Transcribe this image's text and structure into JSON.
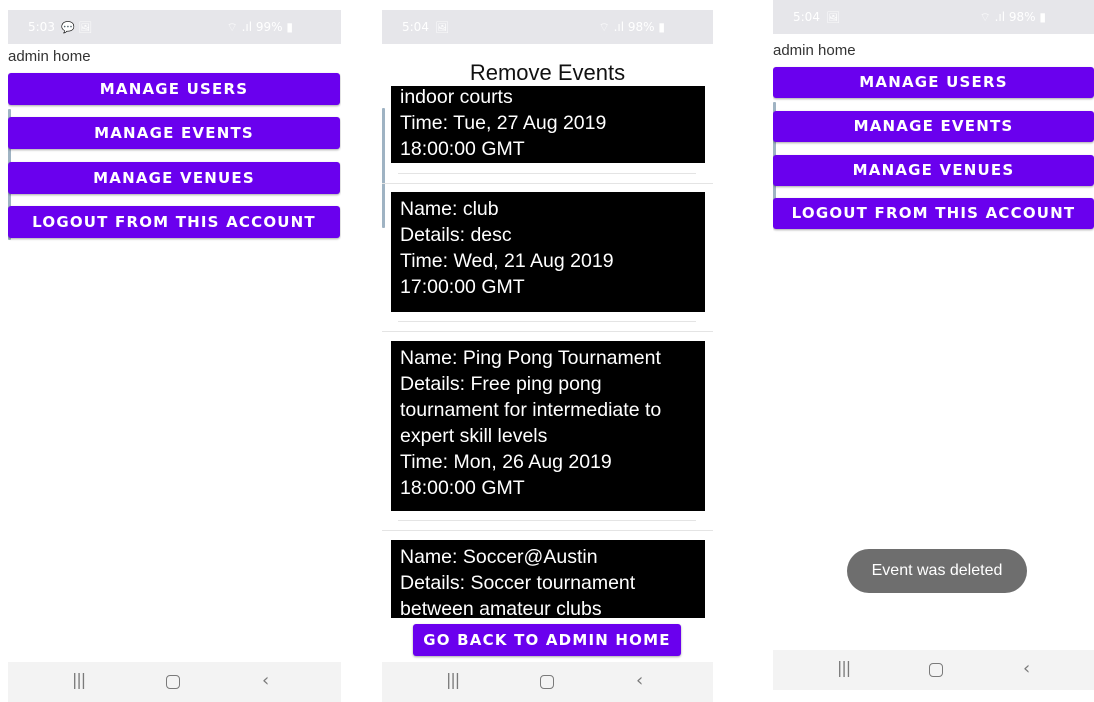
{
  "screens": [
    {
      "status": {
        "time": "5:03",
        "icons_left": "💬 🖼",
        "system": "⌔ .ıl 99% ▮"
      },
      "title": "admin home",
      "buttons": [
        "MANAGE USERS",
        "MANAGE EVENTS",
        "MANAGE VENUES",
        "LOGOUT FROM THIS ACCOUNT"
      ]
    },
    {
      "status": {
        "time": "5:04",
        "icons_left": "🖼",
        "system": "⌔ .ıl 98% ▮"
      },
      "title": "Remove Events",
      "events": [
        {
          "text": "indoor courts\nTime: Tue, 27 Aug 2019\n18:00:00 GMT"
        },
        {
          "text": "Name: club\nDetails: desc\nTime: Wed, 21 Aug 2019\n17:00:00 GMT"
        },
        {
          "text": "Name: Ping Pong Tournament\nDetails: Free ping pong\ntournament for intermediate to\nexpert skill levels\nTime: Mon, 26 Aug 2019\n18:00:00 GMT"
        },
        {
          "text": "Name: Soccer@Austin\nDetails: Soccer tournament\nbetween amateur clubs"
        }
      ],
      "back_button": "GO BACK TO ADMIN HOME"
    },
    {
      "status": {
        "time": "5:04",
        "icons_left": "🖼",
        "system": "⌔ .ıl 98% ▮"
      },
      "title": "admin home",
      "buttons": [
        "MANAGE USERS",
        "MANAGE EVENTS",
        "MANAGE VENUES",
        "LOGOUT FROM THIS ACCOUNT"
      ],
      "toast": "Event was deleted"
    }
  ],
  "navbar": {
    "recents": "|||",
    "home": "",
    "back": "‹"
  },
  "colors": {
    "primary": "#6a00ee",
    "status_bar": "#e6e6ea",
    "card": "#000000",
    "toast": "#6e6e6e"
  }
}
